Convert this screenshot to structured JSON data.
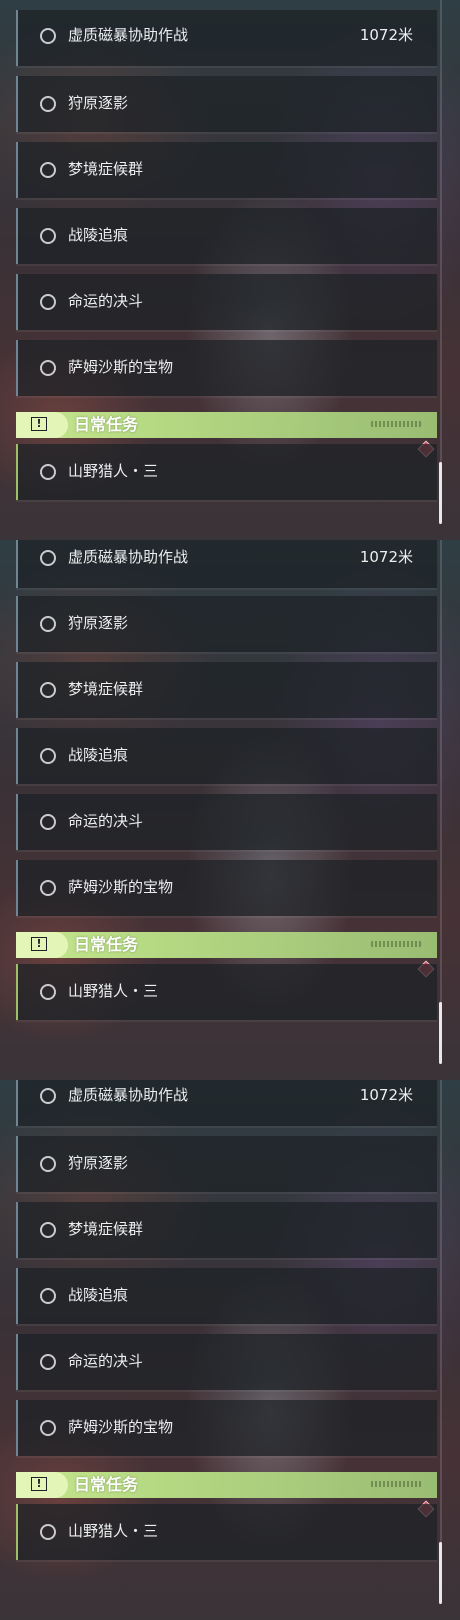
{
  "panels": [
    {
      "missions": [
        {
          "label": "虚质磁暴协助作战",
          "distance": "1072米"
        },
        {
          "label": "狩原逐影"
        },
        {
          "label": "梦境症候群"
        },
        {
          "label": "战陵追痕"
        },
        {
          "label": "命运的决斗"
        },
        {
          "label": "萨姆沙斯的宝物"
        }
      ],
      "section_title": "日常任务",
      "section_icon": "exclamation-box-icon",
      "daily": [
        {
          "label": "山野猎人・三"
        }
      ]
    },
    {
      "missions": [
        {
          "label": "虚质磁暴协助作战",
          "distance": "1072米"
        },
        {
          "label": "狩原逐影"
        },
        {
          "label": "梦境症候群"
        },
        {
          "label": "战陵追痕"
        },
        {
          "label": "命运的决斗"
        },
        {
          "label": "萨姆沙斯的宝物"
        }
      ],
      "section_title": "日常任务",
      "section_icon": "exclamation-box-icon",
      "daily": [
        {
          "label": "山野猎人・三"
        }
      ]
    },
    {
      "missions": [
        {
          "label": "虚质磁暴协助作战",
          "distance": "1072米"
        },
        {
          "label": "狩原逐影"
        },
        {
          "label": "梦境症候群"
        },
        {
          "label": "战陵追痕"
        },
        {
          "label": "命运的决斗"
        },
        {
          "label": "萨姆沙斯的宝物"
        }
      ],
      "section_title": "日常任务",
      "section_icon": "exclamation-box-icon",
      "daily": [
        {
          "label": "山野猎人・三"
        }
      ]
    }
  ],
  "colors": {
    "section_accent": "#b2d681",
    "daily_bar": "#9fbf64",
    "mission_bar": "#6f8594",
    "marker": "#c75060"
  }
}
